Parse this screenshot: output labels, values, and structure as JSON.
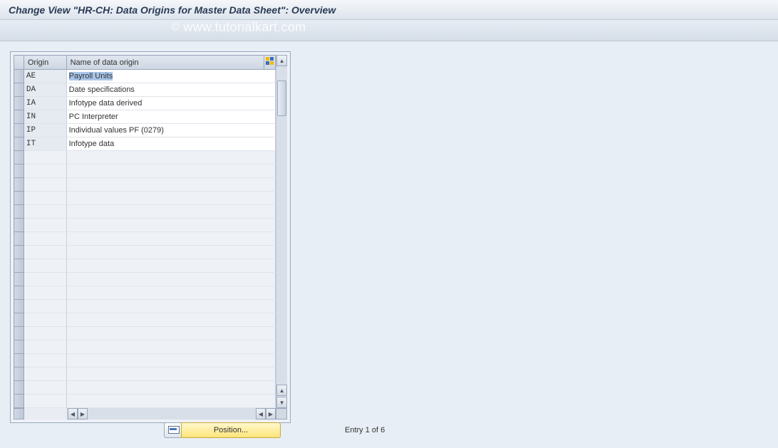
{
  "title": "Change View \"HR-CH: Data Origins for Master Data Sheet\": Overview",
  "watermark": "www.tutorialkart.com",
  "columns": {
    "origin": "Origin",
    "name": "Name of data origin"
  },
  "rows": [
    {
      "origin": "AE",
      "name": "Payroll Units",
      "selected": true
    },
    {
      "origin": "DA",
      "name": "Date specifications",
      "selected": false
    },
    {
      "origin": "IA",
      "name": "Infotype data derived",
      "selected": false
    },
    {
      "origin": "IN",
      "name": "PC Interpreter",
      "selected": false
    },
    {
      "origin": "IP",
      "name": "Individual values PF (0279)",
      "selected": false
    },
    {
      "origin": "IT",
      "name": "Infotype data",
      "selected": false
    }
  ],
  "empty_rows": 19,
  "footer": {
    "position_button": "Position...",
    "entry_text": "Entry 1 of 6"
  }
}
